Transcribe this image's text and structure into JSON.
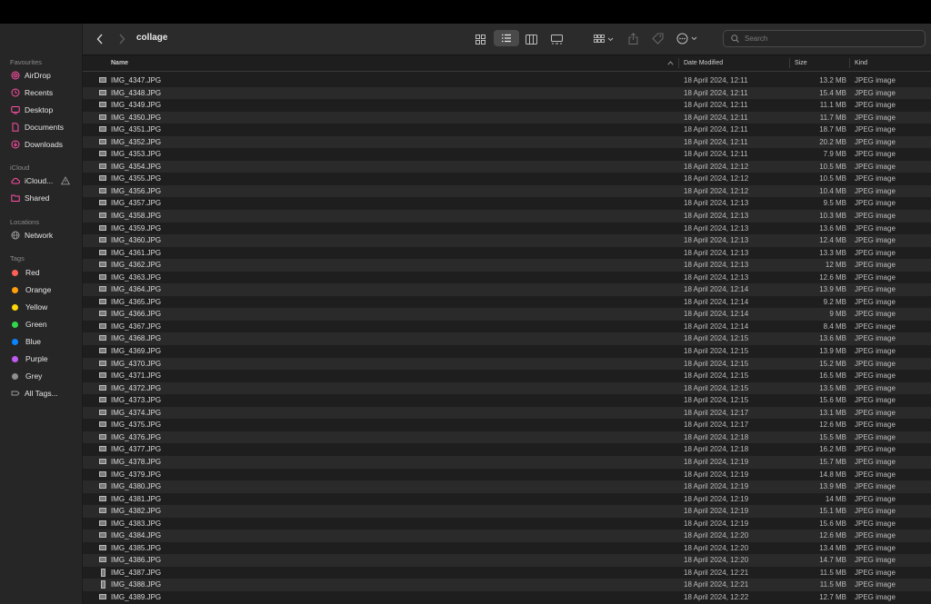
{
  "window": {
    "title": "collage"
  },
  "sidebar": {
    "sections": [
      {
        "label": "Favourites",
        "items": [
          "AirDrop",
          "Recents",
          "Desktop",
          "Documents",
          "Downloads"
        ]
      },
      {
        "label": "iCloud",
        "items": [
          "iCloud...",
          "Shared"
        ]
      },
      {
        "label": "Locations",
        "items": [
          "Network"
        ]
      },
      {
        "label": "Tags",
        "items": [
          "Red",
          "Orange",
          "Yellow",
          "Green",
          "Blue",
          "Purple",
          "Grey",
          "All Tags..."
        ]
      }
    ],
    "tag_colors": {
      "Red": "#ff5f57",
      "Orange": "#ff9f0a",
      "Yellow": "#ffd60a",
      "Green": "#32d74b",
      "Blue": "#0a84ff",
      "Purple": "#bf5af2",
      "Grey": "#8e8e93"
    },
    "accent_color": "#ff4fa3"
  },
  "toolbar": {
    "search_placeholder": "Search",
    "icons": [
      "back-icon",
      "forward-icon",
      "icon-view-icon",
      "list-view-icon",
      "column-view-icon",
      "gallery-view-icon",
      "group-icon",
      "share-icon",
      "tag-icon",
      "more-icon",
      "search-icon"
    ],
    "selected_view": "list"
  },
  "table": {
    "columns": [
      "Name",
      "Date Modified",
      "Size",
      "Kind"
    ],
    "sort_column": "Name",
    "rows": [
      {
        "name": "IMG_4347.JPG",
        "date": "18 April 2024, 12:11",
        "size": "13.2 MB",
        "kind": "JPEG image"
      },
      {
        "name": "IMG_4348.JPG",
        "date": "18 April 2024, 12:11",
        "size": "15.4 MB",
        "kind": "JPEG image"
      },
      {
        "name": "IMG_4349.JPG",
        "date": "18 April 2024, 12:11",
        "size": "11.1 MB",
        "kind": "JPEG image"
      },
      {
        "name": "IMG_4350.JPG",
        "date": "18 April 2024, 12:11",
        "size": "11.7 MB",
        "kind": "JPEG image"
      },
      {
        "name": "IMG_4351.JPG",
        "date": "18 April 2024, 12:11",
        "size": "18.7 MB",
        "kind": "JPEG image"
      },
      {
        "name": "IMG_4352.JPG",
        "date": "18 April 2024, 12:11",
        "size": "20.2 MB",
        "kind": "JPEG image"
      },
      {
        "name": "IMG_4353.JPG",
        "date": "18 April 2024, 12:11",
        "size": "7.9 MB",
        "kind": "JPEG image"
      },
      {
        "name": "IMG_4354.JPG",
        "date": "18 April 2024, 12:12",
        "size": "10.5 MB",
        "kind": "JPEG image"
      },
      {
        "name": "IMG_4355.JPG",
        "date": "18 April 2024, 12:12",
        "size": "10.5 MB",
        "kind": "JPEG image"
      },
      {
        "name": "IMG_4356.JPG",
        "date": "18 April 2024, 12:12",
        "size": "10.4 MB",
        "kind": "JPEG image"
      },
      {
        "name": "IMG_4357.JPG",
        "date": "18 April 2024, 12:13",
        "size": "9.5 MB",
        "kind": "JPEG image"
      },
      {
        "name": "IMG_4358.JPG",
        "date": "18 April 2024, 12:13",
        "size": "10.3 MB",
        "kind": "JPEG image"
      },
      {
        "name": "IMG_4359.JPG",
        "date": "18 April 2024, 12:13",
        "size": "13.6 MB",
        "kind": "JPEG image"
      },
      {
        "name": "IMG_4360.JPG",
        "date": "18 April 2024, 12:13",
        "size": "12.4 MB",
        "kind": "JPEG image"
      },
      {
        "name": "IMG_4361.JPG",
        "date": "18 April 2024, 12:13",
        "size": "13.3 MB",
        "kind": "JPEG image"
      },
      {
        "name": "IMG_4362.JPG",
        "date": "18 April 2024, 12:13",
        "size": "12 MB",
        "kind": "JPEG image"
      },
      {
        "name": "IMG_4363.JPG",
        "date": "18 April 2024, 12:13",
        "size": "12.6 MB",
        "kind": "JPEG image"
      },
      {
        "name": "IMG_4364.JPG",
        "date": "18 April 2024, 12:14",
        "size": "13.9 MB",
        "kind": "JPEG image"
      },
      {
        "name": "IMG_4365.JPG",
        "date": "18 April 2024, 12:14",
        "size": "9.2 MB",
        "kind": "JPEG image"
      },
      {
        "name": "IMG_4366.JPG",
        "date": "18 April 2024, 12:14",
        "size": "9 MB",
        "kind": "JPEG image"
      },
      {
        "name": "IMG_4367.JPG",
        "date": "18 April 2024, 12:14",
        "size": "8.4 MB",
        "kind": "JPEG image"
      },
      {
        "name": "IMG_4368.JPG",
        "date": "18 April 2024, 12:15",
        "size": "13.6 MB",
        "kind": "JPEG image"
      },
      {
        "name": "IMG_4369.JPG",
        "date": "18 April 2024, 12:15",
        "size": "13.9 MB",
        "kind": "JPEG image"
      },
      {
        "name": "IMG_4370.JPG",
        "date": "18 April 2024, 12:15",
        "size": "15.2 MB",
        "kind": "JPEG image"
      },
      {
        "name": "IMG_4371.JPG",
        "date": "18 April 2024, 12:15",
        "size": "16.5 MB",
        "kind": "JPEG image"
      },
      {
        "name": "IMG_4372.JPG",
        "date": "18 April 2024, 12:15",
        "size": "13.5 MB",
        "kind": "JPEG image"
      },
      {
        "name": "IMG_4373.JPG",
        "date": "18 April 2024, 12:15",
        "size": "15.6 MB",
        "kind": "JPEG image"
      },
      {
        "name": "IMG_4374.JPG",
        "date": "18 April 2024, 12:17",
        "size": "13.1 MB",
        "kind": "JPEG image"
      },
      {
        "name": "IMG_4375.JPG",
        "date": "18 April 2024, 12:17",
        "size": "12.6 MB",
        "kind": "JPEG image"
      },
      {
        "name": "IMG_4376.JPG",
        "date": "18 April 2024, 12:18",
        "size": "15.5 MB",
        "kind": "JPEG image"
      },
      {
        "name": "IMG_4377.JPG",
        "date": "18 April 2024, 12:18",
        "size": "16.2 MB",
        "kind": "JPEG image"
      },
      {
        "name": "IMG_4378.JPG",
        "date": "18 April 2024, 12:19",
        "size": "15.7 MB",
        "kind": "JPEG image"
      },
      {
        "name": "IMG_4379.JPG",
        "date": "18 April 2024, 12:19",
        "size": "14.8 MB",
        "kind": "JPEG image"
      },
      {
        "name": "IMG_4380.JPG",
        "date": "18 April 2024, 12:19",
        "size": "13.9 MB",
        "kind": "JPEG image"
      },
      {
        "name": "IMG_4381.JPG",
        "date": "18 April 2024, 12:19",
        "size": "14 MB",
        "kind": "JPEG image"
      },
      {
        "name": "IMG_4382.JPG",
        "date": "18 April 2024, 12:19",
        "size": "15.1 MB",
        "kind": "JPEG image"
      },
      {
        "name": "IMG_4383.JPG",
        "date": "18 April 2024, 12:19",
        "size": "15.6 MB",
        "kind": "JPEG image"
      },
      {
        "name": "IMG_4384.JPG",
        "date": "18 April 2024, 12:20",
        "size": "12.6 MB",
        "kind": "JPEG image"
      },
      {
        "name": "IMG_4385.JPG",
        "date": "18 April 2024, 12:20",
        "size": "13.4 MB",
        "kind": "JPEG image"
      },
      {
        "name": "IMG_4386.JPG",
        "date": "18 April 2024, 12:20",
        "size": "14.7 MB",
        "kind": "JPEG image"
      },
      {
        "name": "IMG_4387.JPG",
        "date": "18 April 2024, 12:21",
        "size": "11.5 MB",
        "kind": "JPEG image",
        "portrait": true
      },
      {
        "name": "IMG_4388.JPG",
        "date": "18 April 2024, 12:21",
        "size": "11.5 MB",
        "kind": "JPEG image",
        "portrait": true
      },
      {
        "name": "IMG_4389.JPG",
        "date": "18 April 2024, 12:22",
        "size": "12.7 MB",
        "kind": "JPEG image"
      }
    ]
  }
}
